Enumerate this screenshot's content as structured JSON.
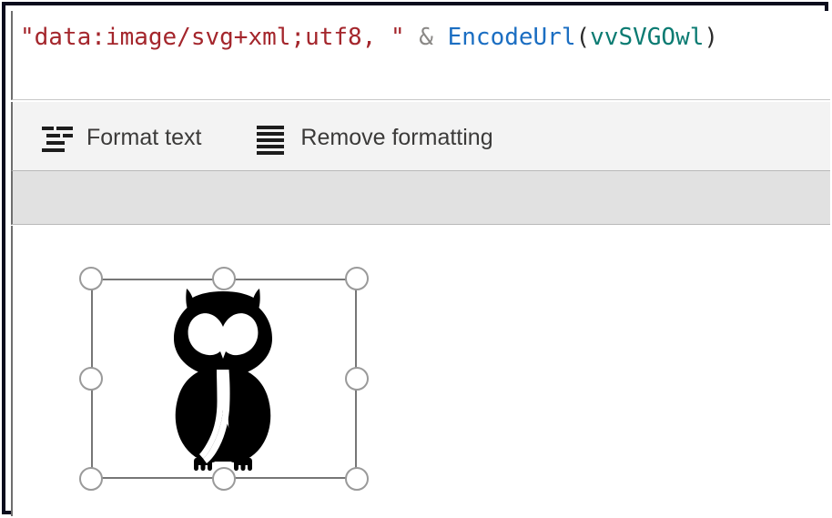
{
  "window": {
    "border_color": "#0b0c1c",
    "background": "#ffffff"
  },
  "formula_bar": {
    "name": "formula-bar",
    "full_text": "\"data:image/svg+xml;utf8, \" & EncodeUrl(vvSVGOwl)",
    "tokens": {
      "string_literal": "\"data:image/svg+xml;utf8, \"",
      "operator": "&",
      "function_name": "EncodeUrl",
      "open_paren": "(",
      "variable": "vvSVGOwl",
      "close_paren": ")"
    },
    "colors": {
      "string": "#a4262c",
      "operator": "#8a8886",
      "function": "#1b6ec2",
      "variable": "#0b7b72",
      "paren": "#2b2b2b"
    }
  },
  "toolbar": {
    "name": "format-toolbar",
    "background": "#f3f3f3",
    "items": [
      {
        "icon": "format-text-icon",
        "label": "Format text"
      },
      {
        "icon": "remove-formatting-icon",
        "label": "Remove formatting"
      }
    ]
  },
  "gray_strip": {
    "color": "#e1e1e1"
  },
  "canvas": {
    "name": "design-canvas",
    "background": "#ffffff",
    "selection": {
      "name": "image-control-selection",
      "border_color": "#767676",
      "handle_fill": "#ffffff",
      "handle_stroke": "#9a9a9a",
      "handles": [
        "top-left",
        "top-center",
        "top-right",
        "middle-left",
        "middle-right",
        "bottom-left",
        "bottom-center",
        "bottom-right"
      ],
      "content": {
        "name": "owl-svg-image",
        "alt": "owl",
        "fill": "#000000"
      }
    }
  }
}
